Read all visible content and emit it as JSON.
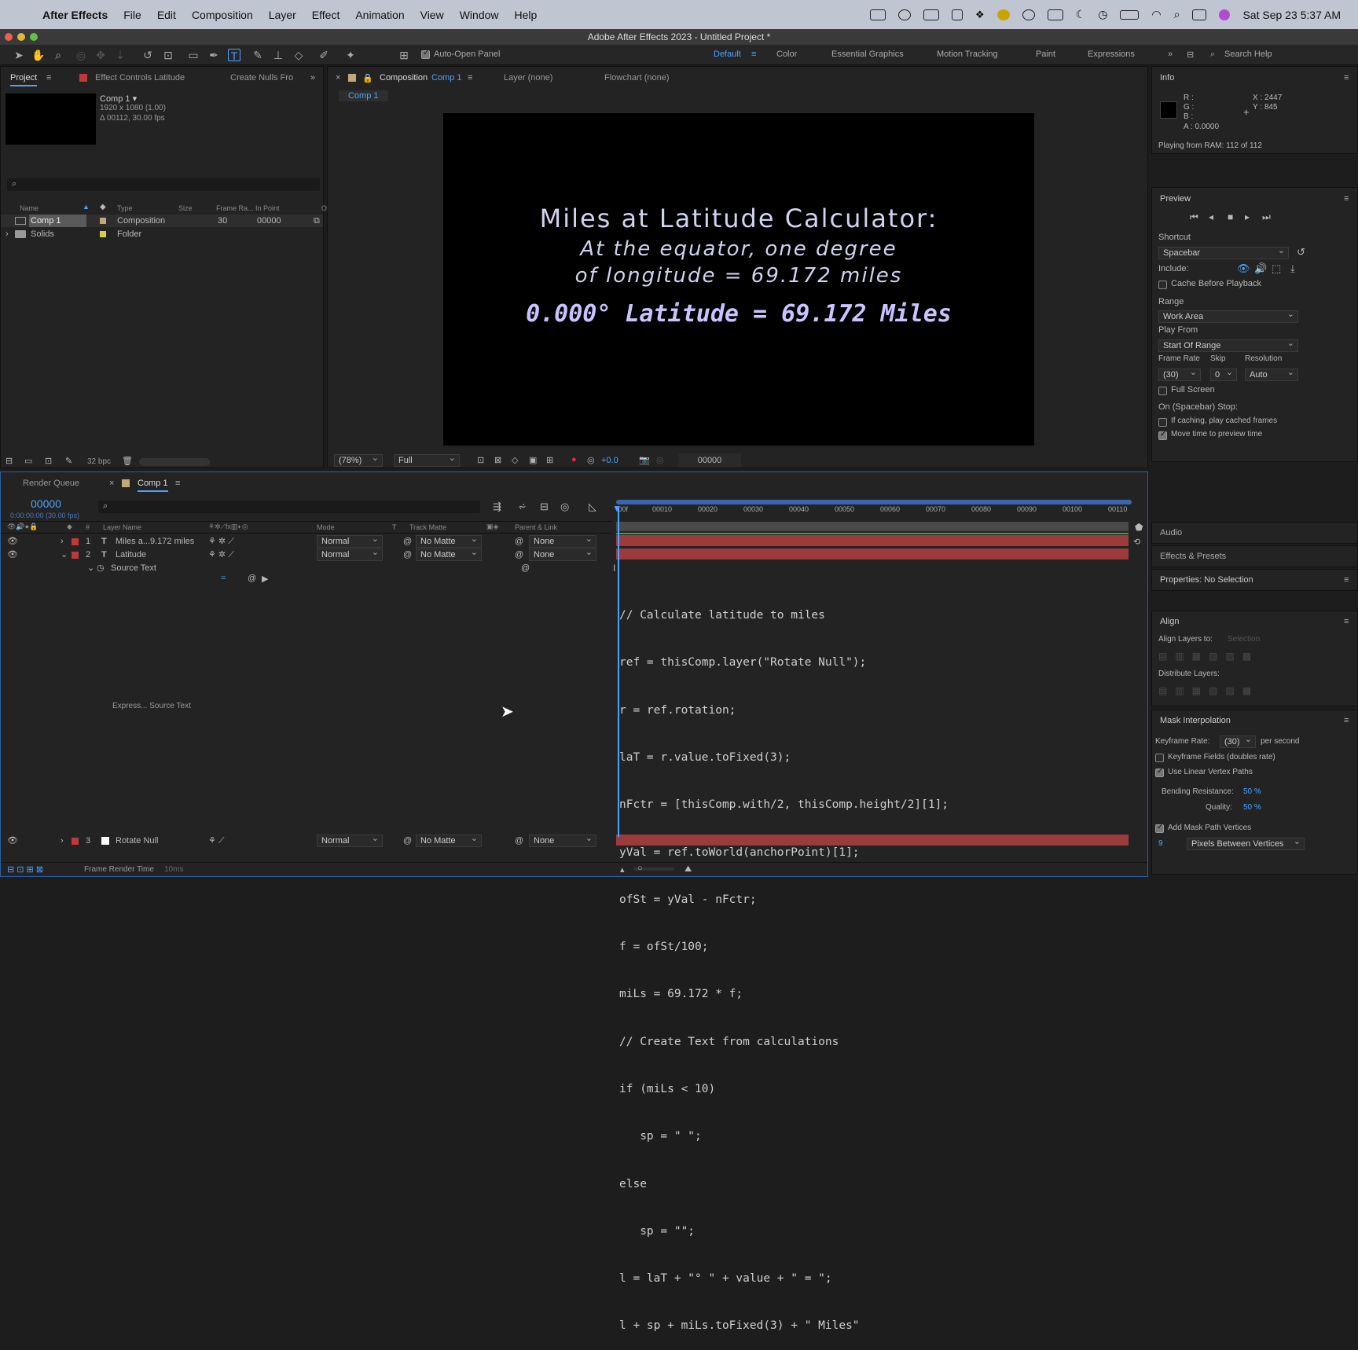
{
  "menubar": {
    "app": "After Effects",
    "items": [
      "File",
      "Edit",
      "Composition",
      "Layer",
      "Effect",
      "Animation",
      "View",
      "Window",
      "Help"
    ],
    "datetime": "Sat Sep 23  5:37 AM"
  },
  "window_title": "Adobe After Effects 2023 - Untitled Project *",
  "toolbar": {
    "auto_open": "Auto-Open Panel",
    "workspaces": [
      "Default",
      "Color",
      "Essential Graphics",
      "Motion Tracking",
      "Paint",
      "Expressions"
    ],
    "search_placeholder": "Search Help"
  },
  "project": {
    "tabs": [
      "Project",
      "Effect Controls Latitude",
      "Create Nulls Fro"
    ],
    "comp_name": "Comp 1 ▾",
    "comp_res": "1920 x 1080 (1.00)",
    "comp_dur": "Δ 00112, 30.00 fps",
    "columns": [
      "Name",
      "Type",
      "Size",
      "Frame Ra...",
      "In Point",
      "O"
    ],
    "items": [
      {
        "name": "Comp 1",
        "type": "Composition",
        "fps": "30",
        "in": "00000"
      },
      {
        "name": "Solids",
        "type": "Folder",
        "fps": "",
        "in": ""
      }
    ],
    "bpc": "32 bpc"
  },
  "comp_panel": {
    "tab": "Composition",
    "tab_comp": "Comp 1",
    "layer_tab": "Layer (none)",
    "flow_tab": "Flowchart (none)",
    "sub_tab": "Comp 1",
    "title": "Miles at Latitude Calculator:",
    "line2": "At the equator, one degree",
    "line3": "of longitude = 69.172 miles",
    "result": "0.000° Latitude = 69.172 Miles",
    "zoom": "(78%)",
    "quality": "Full",
    "exposure": "+0.0",
    "timecode": "00000"
  },
  "info": {
    "title": "Info",
    "r": "R :",
    "g": "G :",
    "b": "B :",
    "a": "A :  0.0000",
    "x": "X : 2447",
    "y": "Y :  845",
    "playing": "Playing from RAM: 112 of 112"
  },
  "preview": {
    "title": "Preview",
    "shortcut_label": "Shortcut",
    "shortcut": "Spacebar",
    "include": "Include:",
    "cache": "Cache Before Playback",
    "range_label": "Range",
    "range": "Work Area",
    "play_from_label": "Play From",
    "play_from": "Start Of Range",
    "fr_label": "Frame Rate",
    "skip_label": "Skip",
    "res_label": "Resolution",
    "fr": "(30)",
    "skip": "0",
    "res": "Auto",
    "full_screen": "Full Screen",
    "on_stop": "On (Spacebar) Stop:",
    "if_caching": "If caching, play cached frames",
    "move_time": "Move time to preview time"
  },
  "panels": {
    "audio": "Audio",
    "effects": "Effects & Presets",
    "properties": "Properties: No Selection",
    "align": "Align",
    "align_to": "Align Layers to:",
    "align_sel": "Selection",
    "distribute": "Distribute Layers:",
    "mask": "Mask Interpolation",
    "kf_rate_label": "Keyframe Rate:",
    "kf_rate": "(30)",
    "per_second": "per second",
    "kf_fields": "Keyframe Fields (doubles rate)",
    "linear": "Use Linear Vertex Paths",
    "bending": "Bending Resistance:",
    "bending_val": "50 %",
    "quality": "Quality:",
    "quality_val": "50 %",
    "add_mask": "Add Mask Path Vertices",
    "vertex_num": "9",
    "pixels_between": "Pixels Between Vertices"
  },
  "timeline": {
    "render_queue": "Render Queue",
    "comp_tab": "Comp 1",
    "timecode": "00000",
    "timecode_sub": "0:00:00:00 (30.00 fps)",
    "cols": [
      "#",
      "Layer Name",
      "Mode",
      "T",
      "Track Matte",
      "Parent & Link"
    ],
    "layers": [
      {
        "num": "1",
        "name": "Miles a...9.172 miles",
        "mode": "Normal",
        "matte": "No Matte",
        "parent": "None"
      },
      {
        "num": "2",
        "name": "Latitude",
        "mode": "Normal",
        "matte": "No Matte",
        "parent": "None"
      },
      {
        "num": "3",
        "name": "Rotate Null",
        "mode": "Normal",
        "matte": "No Matte",
        "parent": "None"
      }
    ],
    "source_text": "Source Text",
    "expr_label": "Express... Source Text",
    "ticks": [
      "00010",
      "00020",
      "00030",
      "00040",
      "00050",
      "00060",
      "00070",
      "00080",
      "00090",
      "00100",
      "00110"
    ],
    "frame_render": "Frame Render Time",
    "frame_render_val": "10ms"
  },
  "expression": [
    "// Calculate latitude to miles",
    "ref = thisComp.layer(\"Rotate Null\");",
    "r = ref.rotation;",
    "laT = r.value.toFixed(3);",
    "nFctr = [thisComp.with/2, thisComp.height/2][1];",
    "yVal = ref.toWorld(anchorPoint)[1];",
    "ofSt = yVal - nFctr;",
    "f = ofSt/100;",
    "miLs = 69.172 * f;",
    "// Create Text from calculations",
    "if (miLs < 10)",
    "   sp = \" \";",
    "else",
    "   sp = \"\";",
    "l = laT + \"° \" + value + \" = \";",
    "l + sp + miLs.toFixed(3) + \" Miles\""
  ]
}
